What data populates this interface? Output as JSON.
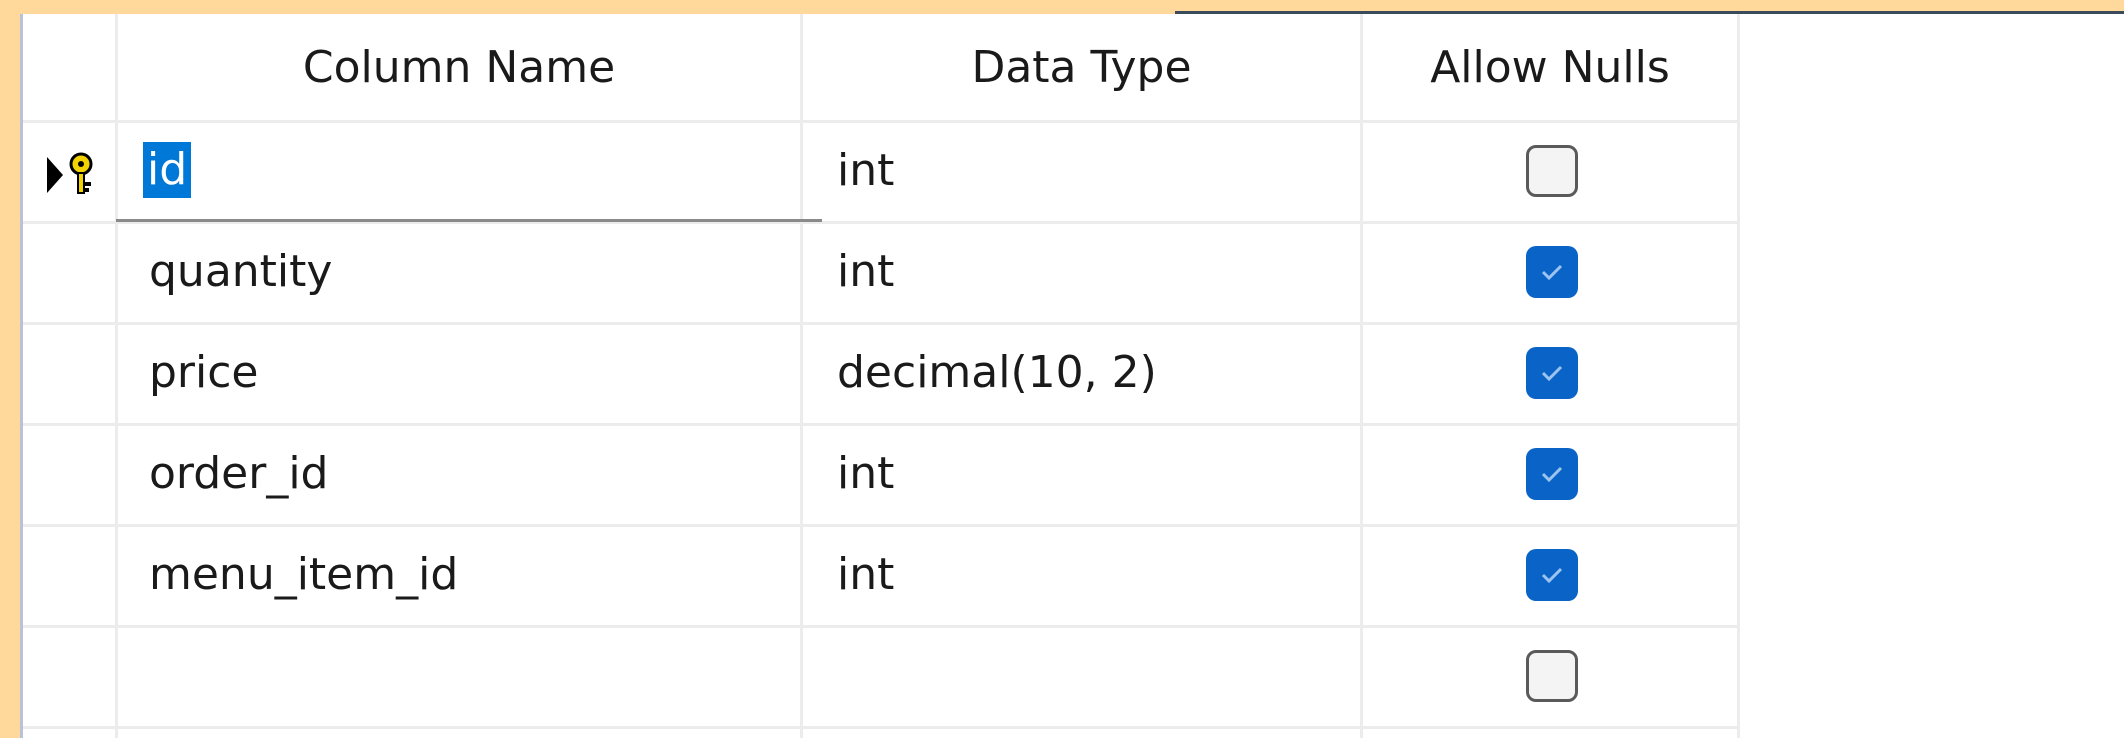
{
  "table_designer": {
    "columns": {
      "name": "Column Name",
      "type": "Data Type",
      "nulls": "Allow Nulls"
    },
    "rows": [
      {
        "name": "id",
        "type": "int",
        "allow_nulls": false,
        "primary_key": true,
        "selected": true
      },
      {
        "name": "quantity",
        "type": "int",
        "allow_nulls": true
      },
      {
        "name": "price",
        "type": "decimal(10, 2)",
        "allow_nulls": true
      },
      {
        "name": "order_id",
        "type": "int",
        "allow_nulls": true
      },
      {
        "name": "menu_item_id",
        "type": "int",
        "allow_nulls": true
      },
      {
        "name": "",
        "type": "",
        "allow_nulls": false
      }
    ]
  },
  "colors": {
    "selection": "#0078d7",
    "checkbox_checked": "#0a64c8",
    "window_border": "#ffd89c"
  },
  "icons": {
    "row_marker": "current-row-arrow-icon",
    "key": "primary-key-icon"
  }
}
